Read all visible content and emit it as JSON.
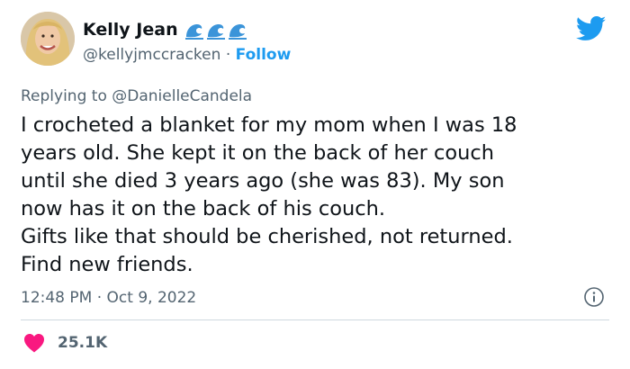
{
  "user": {
    "display_name": "Kelly Jean",
    "handle": "@kellyjmccracken",
    "separator": "·",
    "follow_label": "Follow",
    "badge_icons": [
      "water-wave-icon",
      "water-wave-icon",
      "water-wave-icon"
    ]
  },
  "reply": {
    "prefix": "Replying to",
    "to_handle": "@DanielleCandela"
  },
  "tweet": {
    "lines": [
      "I crocheted a blanket for my mom when I was 18",
      "years old. She kept it on the back of her couch",
      "until she died 3 years ago (she was 83). My son",
      "now has it on the back of his couch.",
      "Gifts like that should be cherished, not returned.",
      "Find new friends."
    ]
  },
  "meta": {
    "timestamp": "12:48 PM · Oct 9, 2022"
  },
  "engagement": {
    "like_count": "25.1K"
  },
  "colors": {
    "link": "#1d9bf0",
    "muted": "#536471",
    "text": "#0f1419",
    "heart": "#f91880",
    "divider": "#cfd9de"
  }
}
